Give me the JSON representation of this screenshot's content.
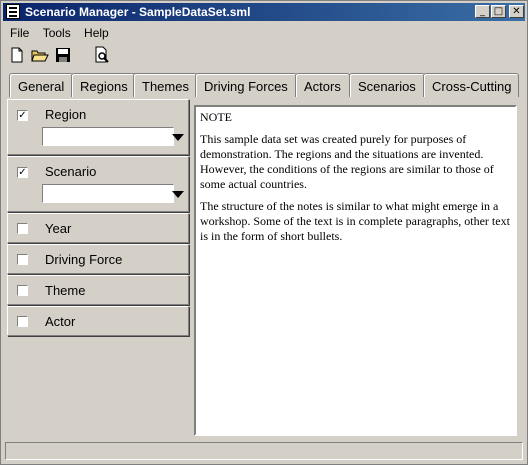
{
  "window": {
    "title": "Scenario Manager - SampleDataSet.sml",
    "minimize": "_",
    "maximize": "□",
    "close": "✕"
  },
  "menu": [
    "File",
    "Tools",
    "Help"
  ],
  "toolbar": {
    "icons": [
      "new-icon",
      "open-folder-icon",
      "save-icon",
      "print-preview-icon"
    ]
  },
  "tabs": [
    "General",
    "Regions",
    "Themes",
    "Driving Forces",
    "Actors",
    "Scenarios",
    "Cross-Cutting"
  ],
  "filters": [
    {
      "label": "Region",
      "checked": true,
      "value": ""
    },
    {
      "label": "Scenario",
      "checked": true,
      "value": ""
    },
    {
      "label": "Year",
      "checked": false
    },
    {
      "label": "Driving Force",
      "checked": false
    },
    {
      "label": "Theme",
      "checked": false
    },
    {
      "label": "Actor",
      "checked": false
    }
  ],
  "notes": {
    "heading": "NOTE",
    "paragraphs": [
      "This sample data set was created purely for purposes of demonstration. The regions and the situations are invented. However, the conditions of the regions are similar to those of some actual countries.",
      "The structure of the notes is similar to what might emerge in a workshop. Some of the text is in complete paragraphs, other text is in the form of short bullets."
    ]
  },
  "checkmark": "✓",
  "statusbar": {
    "text": ""
  }
}
